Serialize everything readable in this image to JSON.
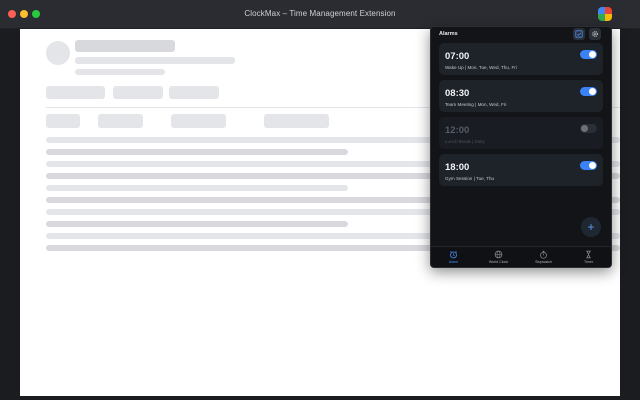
{
  "window": {
    "title": "ClockMax – Time Management Extension"
  },
  "extension": {
    "icon": "extension-puzzle-icon"
  },
  "popup": {
    "title": "Alarms",
    "header_icons": [
      "check-square-icon",
      "gear-icon"
    ],
    "alarms": [
      {
        "time": "07:00",
        "label": "Wake Up | Mon, Tue, Wed, Thu, Fri",
        "enabled": true
      },
      {
        "time": "08:30",
        "label": "Team Meeting | Mon, Wed, Fri",
        "enabled": true
      },
      {
        "time": "12:00",
        "label": "Lunch Break | Daily",
        "enabled": false
      },
      {
        "time": "18:00",
        "label": "Gym Session | Tue, Thu",
        "enabled": true
      }
    ],
    "fab_label": "+",
    "nav": [
      {
        "label": "Alarm",
        "icon": "alarm-clock-icon",
        "active": true
      },
      {
        "label": "World Clock",
        "icon": "globe-icon",
        "active": false
      },
      {
        "label": "Stopwatch",
        "icon": "stopwatch-icon",
        "active": false
      },
      {
        "label": "Timer",
        "icon": "hourglass-icon",
        "active": false
      }
    ]
  },
  "colors": {
    "accent": "#3b82f6",
    "popup_bg": "#121418",
    "card_bg": "#1e2229"
  }
}
